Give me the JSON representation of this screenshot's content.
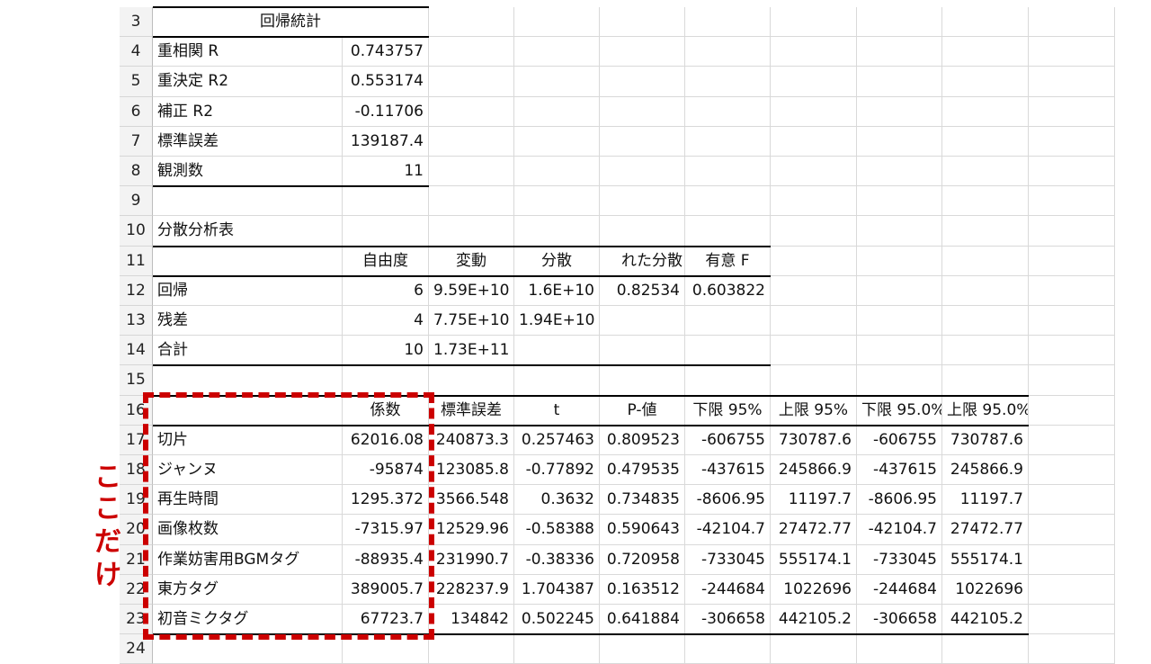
{
  "rows": [
    {
      "num": "3",
      "cells": [
        "回帰統計",
        "",
        "",
        "",
        "",
        "",
        "",
        "",
        "",
        ""
      ]
    },
    {
      "num": "4",
      "cells": [
        "重相関 R",
        "0.743757",
        "",
        "",
        "",
        "",
        "",
        "",
        "",
        ""
      ]
    },
    {
      "num": "5",
      "cells": [
        "重決定 R2",
        "0.553174",
        "",
        "",
        "",
        "",
        "",
        "",
        "",
        ""
      ]
    },
    {
      "num": "6",
      "cells": [
        "補正 R2",
        "-0.11706",
        "",
        "",
        "",
        "",
        "",
        "",
        "",
        ""
      ]
    },
    {
      "num": "7",
      "cells": [
        "標準誤差",
        "139187.4",
        "",
        "",
        "",
        "",
        "",
        "",
        "",
        ""
      ]
    },
    {
      "num": "8",
      "cells": [
        "観測数",
        "11",
        "",
        "",
        "",
        "",
        "",
        "",
        "",
        ""
      ]
    },
    {
      "num": "9",
      "cells": [
        "",
        "",
        "",
        "",
        "",
        "",
        "",
        "",
        "",
        ""
      ]
    },
    {
      "num": "10",
      "cells": [
        "分散分析表",
        "",
        "",
        "",
        "",
        "",
        "",
        "",
        "",
        ""
      ]
    },
    {
      "num": "11",
      "cells": [
        "",
        "自由度",
        "変動",
        "分散",
        "れた分散",
        "有意 F",
        "",
        "",
        "",
        ""
      ]
    },
    {
      "num": "12",
      "cells": [
        "回帰",
        "6",
        "9.59E+10",
        "1.6E+10",
        "0.82534",
        "0.603822",
        "",
        "",
        "",
        ""
      ]
    },
    {
      "num": "13",
      "cells": [
        "残差",
        "4",
        "7.75E+10",
        "1.94E+10",
        "",
        "",
        "",
        "",
        "",
        ""
      ]
    },
    {
      "num": "14",
      "cells": [
        "合計",
        "10",
        "1.73E+11",
        "",
        "",
        "",
        "",
        "",
        "",
        ""
      ]
    },
    {
      "num": "15",
      "cells": [
        "",
        "",
        "",
        "",
        "",
        "",
        "",
        "",
        "",
        ""
      ]
    },
    {
      "num": "16",
      "cells": [
        "",
        "係数",
        "標準誤差",
        "t",
        "P-値",
        "下限 95%",
        "上限 95%",
        "下限 95.0%",
        "上限 95.0%",
        ""
      ]
    },
    {
      "num": "17",
      "cells": [
        "切片",
        "62016.08",
        "240873.3",
        "0.257463",
        "0.809523",
        "-606755",
        "730787.6",
        "-606755",
        "730787.6",
        ""
      ]
    },
    {
      "num": "18",
      "cells": [
        "ジャンヌ",
        "-95874",
        "123085.8",
        "-0.77892",
        "0.479535",
        "-437615",
        "245866.9",
        "-437615",
        "245866.9",
        ""
      ]
    },
    {
      "num": "19",
      "cells": [
        "再生時間",
        "1295.372",
        "3566.548",
        "0.3632",
        "0.734835",
        "-8606.95",
        "11197.7",
        "-8606.95",
        "11197.7",
        ""
      ]
    },
    {
      "num": "20",
      "cells": [
        "画像枚数",
        "-7315.97",
        "12529.96",
        "-0.58388",
        "0.590643",
        "-42104.7",
        "27472.77",
        "-42104.7",
        "27472.77",
        ""
      ]
    },
    {
      "num": "21",
      "cells": [
        "作業妨害用BGMタグ",
        "-88935.4",
        "231990.7",
        "-0.38336",
        "0.720958",
        "-733045",
        "555174.1",
        "-733045",
        "555174.1",
        ""
      ]
    },
    {
      "num": "22",
      "cells": [
        "東方タグ",
        "389005.7",
        "228237.9",
        "1.704387",
        "0.163512",
        "-244684",
        "1022696",
        "-244684",
        "1022696",
        ""
      ]
    },
    {
      "num": "23",
      "cells": [
        "初音ミクタグ",
        "67723.7",
        "134842",
        "0.502245",
        "0.641884",
        "-306658",
        "442105.2",
        "-306658",
        "442105.2",
        ""
      ]
    },
    {
      "num": "24",
      "cells": [
        "",
        "",
        "",
        "",
        "",
        "",
        "",
        "",
        "",
        ""
      ]
    }
  ],
  "annotation": {
    "chars": [
      "こ",
      "こ",
      "だ",
      "け"
    ],
    "color": "#cc0000"
  }
}
